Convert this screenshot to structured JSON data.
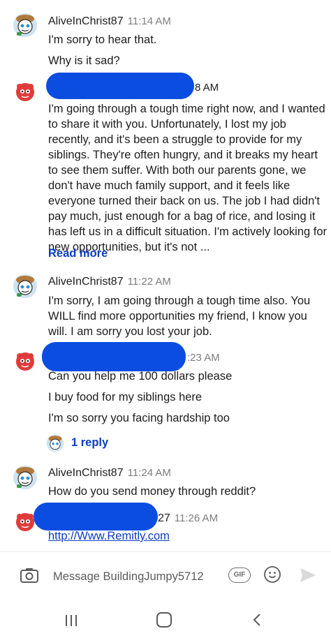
{
  "messages": [
    {
      "username": "AliveInChrist87",
      "time": "11:14 AM",
      "lines": [
        "I'm sorry to hear that.",
        "Why is it sad?"
      ]
    },
    {
      "username": "",
      "time": "8 AM",
      "body": "I'm going through a tough time right now, and I wanted to share it with you. Unfortunately, I lost my job recently, and it's been a struggle to provide for my siblings. They're often hungry, and it breaks my heart to see them suffer. With both our parents gone, we don't have much family support, and it feels like everyone turned their back on us. The job I had didn't pay much, just enough for a bag of rice, and losing it has left us in a difficult situation. I'm actively looking for new opportunities, but it's not ...",
      "read_more": "Read more"
    },
    {
      "username": "AliveInChrist87",
      "time": "11:22 AM",
      "body": "I'm sorry, I am going through a tough time also. You WILL find more opportunities my friend, I know you will. I am sorry you lost your job."
    },
    {
      "username": "",
      "time": ":23 AM",
      "lines": [
        "Can you help me 100 dollars please",
        "I buy food for my siblings here",
        "I'm so sorry you facing hardship too"
      ],
      "reply_count": "1 reply"
    },
    {
      "username": "AliveInChrist87",
      "time": "11:24 AM",
      "lines": [
        "How do you send money through reddit?"
      ]
    },
    {
      "username": "27",
      "time": "11:26 AM",
      "link": "http://Www.Remitly.com"
    }
  ],
  "composer": {
    "placeholder": "Message BuildingJumpy5712",
    "gif_label": "GIF"
  },
  "icons": {
    "camera": "camera-icon",
    "gif": "gif-icon",
    "emoji": "emoji-icon",
    "send": "send-icon",
    "nav_recent": "recent-apps-icon",
    "nav_home": "home-icon",
    "nav_back": "back-icon"
  },
  "colors": {
    "link": "#0a3cc2",
    "redaction": "#0a4de0",
    "timestamp": "#7c7c7c"
  }
}
